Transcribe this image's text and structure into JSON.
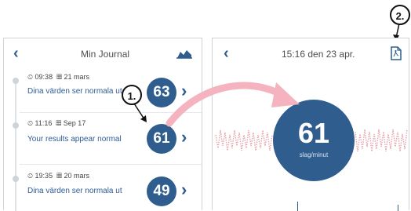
{
  "left_panel": {
    "title": "Min Journal",
    "back_icon": "back-chevron",
    "chart_icon": "chart-icon",
    "rows": [
      {
        "time": "09:38",
        "date": "21 mars",
        "message": "Dina värden ser normala ut",
        "value": "63"
      },
      {
        "time": "11:16",
        "date": "Sep 17",
        "message": "Your results appear normal",
        "value": "61"
      },
      {
        "time": "19:35",
        "date": "20 mars",
        "message": "Dina värden ser normala ut",
        "value": "49"
      }
    ]
  },
  "right_panel": {
    "title": "15:16 den 23 apr.",
    "back_icon": "back-chevron",
    "pdf_icon": "pdf-icon",
    "big_value": "61",
    "unit": "slag/minut"
  },
  "callouts": {
    "one": "1.",
    "two": "2."
  },
  "colors": {
    "accent": "#2f5e8e",
    "arrow": "#f4b3be",
    "wave": "#e7a0aa"
  }
}
